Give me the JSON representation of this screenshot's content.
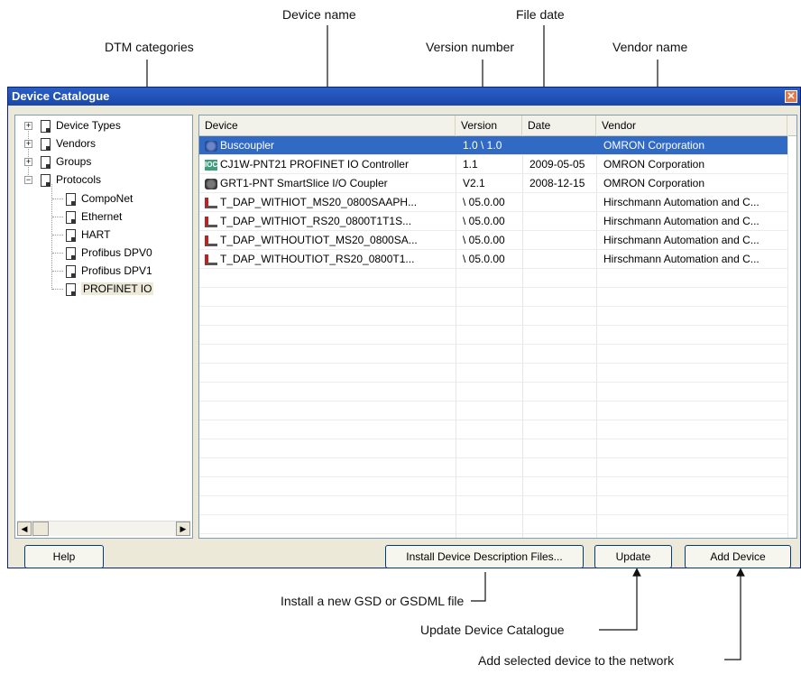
{
  "annotations": {
    "device_name": "Device name",
    "file_date": "File date",
    "dtm_categories": "DTM categories",
    "version_number": "Version number",
    "vendor_name": "Vendor name",
    "install_gsd": "Install a new GSD or GSDML file",
    "update_catalogue": "Update Device Catalogue",
    "add_device": "Add selected device to the network"
  },
  "window": {
    "title": "Device Catalogue",
    "close_glyph": "✕"
  },
  "tree": {
    "items": [
      {
        "label": "Device Types",
        "expander": "+"
      },
      {
        "label": "Vendors",
        "expander": "+"
      },
      {
        "label": "Groups",
        "expander": "+"
      },
      {
        "label": "Protocols",
        "expander": "−"
      }
    ],
    "protocols": [
      "CompoNet",
      "Ethernet",
      "HART",
      "Profibus DPV0",
      "Profibus DPV1",
      "PROFINET IO"
    ]
  },
  "scroll": {
    "left": "◀",
    "right": "▶"
  },
  "table": {
    "headers": [
      "Device",
      "Version",
      "Date",
      "Vendor"
    ],
    "rows": [
      {
        "device": "Buscoupler",
        "version": "1.0 \\ 1.0",
        "date": "",
        "vendor": "OMRON Corporation",
        "icon": "network-icon"
      },
      {
        "device": "CJ1W-PNT21 PROFINET IO Controller",
        "version": "1.1",
        "date": "2009-05-05",
        "vendor": "OMRON Corporation",
        "icon": "ioc-icon"
      },
      {
        "device": "GRT1-PNT SmartSlice I/O Coupler",
        "version": "V2.1",
        "date": "2008-12-15",
        "vendor": "OMRON Corporation",
        "icon": "network-icon"
      },
      {
        "device": "T_DAP_WITHIOT_MS20_0800SAAPH...",
        "version": "\\ 05.0.00",
        "date": "",
        "vendor": "Hirschmann Automation and C...",
        "icon": "switch-icon"
      },
      {
        "device": "T_DAP_WITHIOT_RS20_0800T1T1S...",
        "version": "\\ 05.0.00",
        "date": "",
        "vendor": "Hirschmann Automation and C...",
        "icon": "switch-icon"
      },
      {
        "device": "T_DAP_WITHOUTIOT_MS20_0800SA...",
        "version": "\\ 05.0.00",
        "date": "",
        "vendor": "Hirschmann Automation and C...",
        "icon": "switch-icon"
      },
      {
        "device": "T_DAP_WITHOUTIOT_RS20_0800T1...",
        "version": "\\ 05.0.00",
        "date": "",
        "vendor": "Hirschmann Automation and C...",
        "icon": "switch-icon"
      }
    ]
  },
  "buttons": {
    "help": "Help",
    "install": "Install Device Description Files...",
    "update": "Update",
    "add_device": "Add Device"
  },
  "colors": {
    "selection": "#316ac5",
    "titlebar": "#1a47a8",
    "ioc_icon": "#3aa07a"
  }
}
